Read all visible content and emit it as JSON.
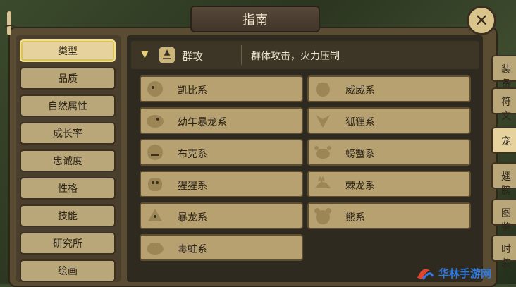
{
  "title": "指南",
  "close_glyph": "✕",
  "sidebar": {
    "items": [
      {
        "label": "类型",
        "active": true
      },
      {
        "label": "品质"
      },
      {
        "label": "自然属性"
      },
      {
        "label": "成长率"
      },
      {
        "label": "忠诚度"
      },
      {
        "label": "性格"
      },
      {
        "label": "技能"
      },
      {
        "label": "研究所"
      },
      {
        "label": "绘画"
      }
    ]
  },
  "category": {
    "title": "群攻",
    "description": "群体攻击，火力压制"
  },
  "items": [
    {
      "label": "凯比系",
      "icon": "kaibi-monster-icon"
    },
    {
      "label": "威威系",
      "icon": "weiwei-monster-icon"
    },
    {
      "label": "幼年暴龙系",
      "icon": "baby-dragon-icon"
    },
    {
      "label": "狐狸系",
      "icon": "fox-monster-icon"
    },
    {
      "label": "布克系",
      "icon": "buke-monster-icon"
    },
    {
      "label": "螃蟹系",
      "icon": "crab-monster-icon"
    },
    {
      "label": "猩猩系",
      "icon": "gorilla-monster-icon"
    },
    {
      "label": "棘龙系",
      "icon": "spine-dragon-icon"
    },
    {
      "label": "暴龙系",
      "icon": "tyrant-dragon-icon"
    },
    {
      "label": "熊系",
      "icon": "bear-monster-icon"
    },
    {
      "label": "毒蛙系",
      "icon": "poison-frog-icon"
    }
  ],
  "right_tabs": [
    "装备",
    "符文",
    "宠",
    "翅膀",
    "图鉴",
    "时装"
  ],
  "watermark": "华林手游网",
  "colors": {
    "accent": "#e6d29c",
    "item_bg": "#b7a170",
    "highlight": "#f2e08f"
  }
}
